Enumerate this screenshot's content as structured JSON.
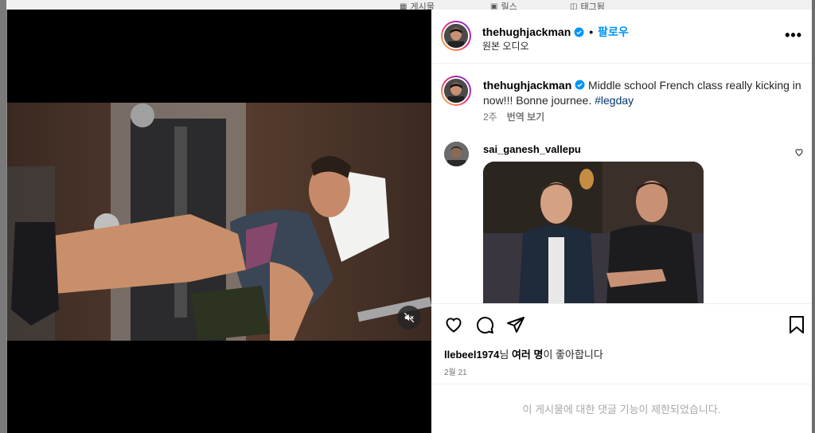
{
  "background": {
    "tabs": [
      {
        "icon": "grid-icon",
        "label": "게시물"
      },
      {
        "icon": "reels-icon",
        "label": "릴스"
      },
      {
        "icon": "tag-icon",
        "label": "태그됨"
      }
    ]
  },
  "post": {
    "username": "thehughjackman",
    "follow_label": "팔로우",
    "audio_label": "원본 오디오",
    "more_icon": "more-options-icon"
  },
  "caption": {
    "username": "thehughjackman",
    "text": "Middle school French class really kicking in now!!! Bonne journee.",
    "hashtag": "#legday",
    "time_ago": "2주",
    "translate_label": "번역 보기"
  },
  "comment": {
    "username": "sai_ganesh_vallepu",
    "attachment": "gif"
  },
  "likes": {
    "user": "llebeel1974",
    "suffix1": "님 ",
    "others": "여러 명",
    "suffix2": "이 좋아합니다"
  },
  "date": "2월 21",
  "comments_restricted": "이 게시물에 대한 댓글 기능이 제한되었습니다.",
  "colors": {
    "accent": "#0095f6",
    "hashtag": "#00376b",
    "muted": "#737373"
  }
}
